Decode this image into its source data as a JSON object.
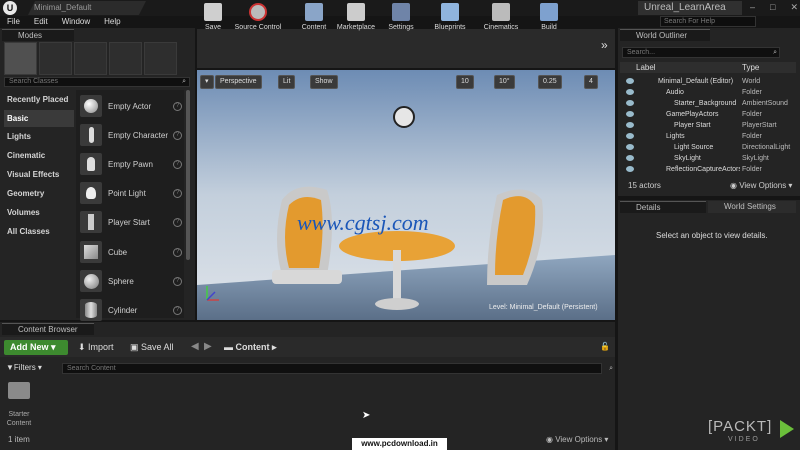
{
  "title_bar": {
    "doc_tab": "Minimal_Default",
    "project_name": "Unreal_LearnArea",
    "win_buttons": [
      "–",
      "□",
      "✕"
    ]
  },
  "menu": [
    "File",
    "Edit",
    "Window",
    "Help"
  ],
  "help_search": {
    "placeholder": "Search For Help"
  },
  "modes": {
    "tab_label": "Modes",
    "search_placeholder": "Search Classes",
    "categories": [
      "Recently Placed",
      "Basic",
      "Lights",
      "Cinematic",
      "Visual Effects",
      "Geometry",
      "Volumes",
      "All Classes"
    ],
    "active_category": "Basic",
    "items": [
      "Empty Actor",
      "Empty Character",
      "Empty Pawn",
      "Point Light",
      "Player Start",
      "Cube",
      "Sphere",
      "Cylinder"
    ]
  },
  "toolbar": {
    "buttons": [
      "Save",
      "Source Control",
      "Content",
      "Marketplace",
      "Settings",
      "Blueprints",
      "Cinematics",
      "Build"
    ],
    "more": "»"
  },
  "viewport": {
    "menu_arrow": "▾",
    "perspective": "Perspective",
    "lit": "Lit",
    "show": "Show",
    "grid_snap": "10",
    "rot_snap": "10°",
    "scale_snap": "0.25",
    "camera_speed": "4",
    "watermark": "www.cgtsj.com",
    "level_label": "Level:  Minimal_Default (Persistent)"
  },
  "content_browser": {
    "tab_label": "Content Browser",
    "add_new": "Add New",
    "import": "Import",
    "save_all": "Save All",
    "path": "Content",
    "filters": "Filters",
    "search_placeholder": "Search Content",
    "folder_name": "Starter Content",
    "item_count": "1 item",
    "view_options": "View Options",
    "watermark": "www.pcdownload.in"
  },
  "world_outliner": {
    "tab_label": "World Outliner",
    "search_placeholder": "Search...",
    "col_label": "Label",
    "col_type": "Type",
    "rows": [
      {
        "label": "Minimal_Default (Editor)",
        "type": "World"
      },
      {
        "label": "Audio",
        "type": "Folder"
      },
      {
        "label": "Starter_Background",
        "type": "AmbientSound"
      },
      {
        "label": "GamePlayActors",
        "type": "Folder"
      },
      {
        "label": "Player Start",
        "type": "PlayerStart"
      },
      {
        "label": "Lights",
        "type": "Folder"
      },
      {
        "label": "Light Source",
        "type": "DirectionalLight"
      },
      {
        "label": "SkyLight",
        "type": "SkyLight"
      },
      {
        "label": "ReflectionCaptureActors",
        "type": "Folder"
      }
    ],
    "actor_count": "15 actors",
    "view_options": "View Options"
  },
  "details": {
    "tab_label": "Details",
    "world_settings_tab": "World Settings",
    "empty_message": "Select an object to view details."
  },
  "packt": {
    "line1": "[PACKT]",
    "line2": "VIDEO"
  },
  "colors": {
    "accent_green": "#3d8a2f",
    "chair_orange": "#e39a2e",
    "sky_top": "#6d8cb4"
  }
}
